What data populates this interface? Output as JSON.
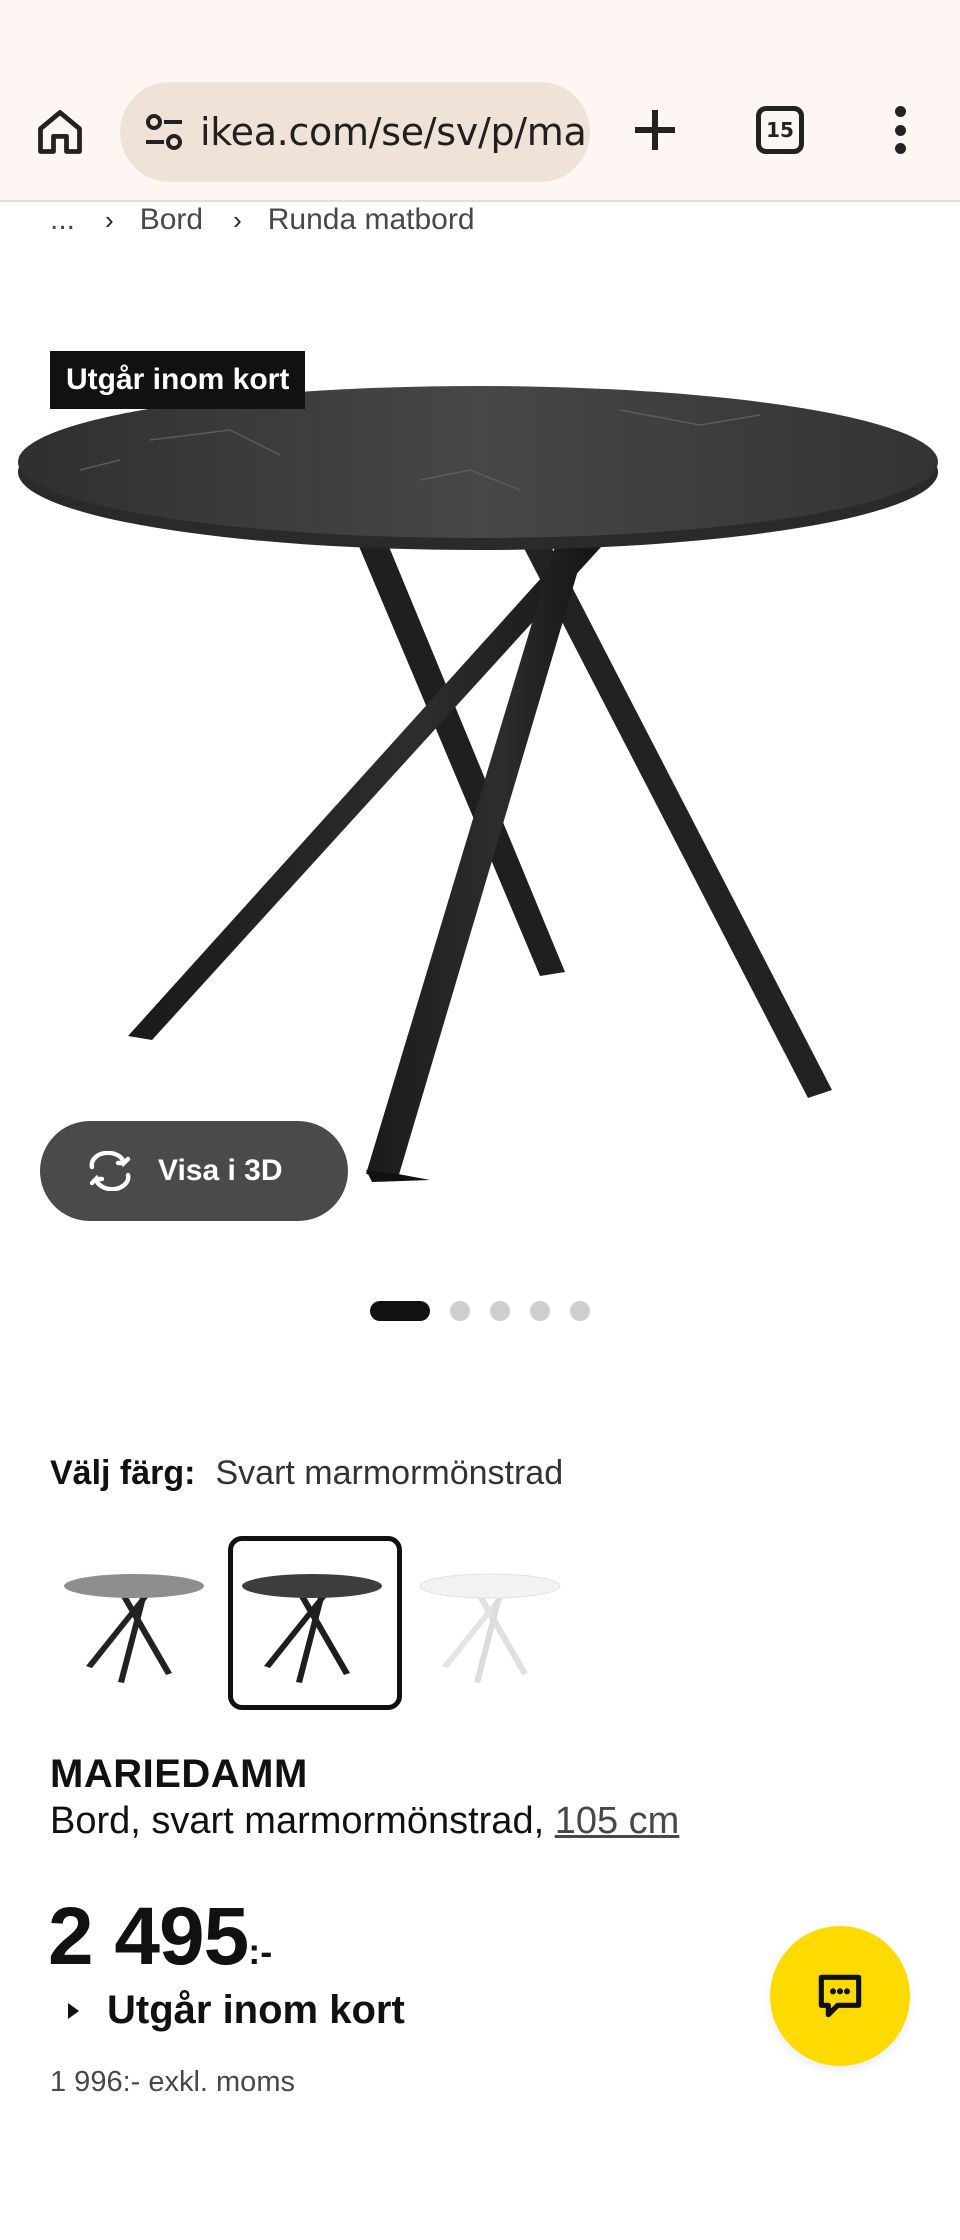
{
  "browser": {
    "url": "ikea.com/se/sv/p/mar",
    "tab_count": "15",
    "icons": [
      "home-icon",
      "site-settings-icon",
      "plus-icon",
      "tab-switcher-icon",
      "more-vertical-icon"
    ]
  },
  "breadcrumb": {
    "items": [
      "...",
      "Bord",
      "Runda matbord"
    ]
  },
  "product_image": {
    "badge": "Utgår inom kort",
    "view3d_label": "Visa i 3D",
    "carousel": {
      "total": 5,
      "active": 1
    }
  },
  "color": {
    "label": "Välj färg:",
    "selected": "Svart marmormönstrad",
    "swatches": [
      {
        "top_color": "#8d8f8d",
        "leg_color": "#222222",
        "selected": false
      },
      {
        "top_color": "#3d3d3d",
        "leg_color": "#1e1e1e",
        "selected": true
      },
      {
        "top_color": "#f2f2f2",
        "leg_color": "#e4e4e4",
        "selected": false
      }
    ]
  },
  "product": {
    "name": "MARIEDAMM",
    "description": "Bord, svart marmormönstrad, ",
    "size": "105 cm",
    "price": "2 495",
    "price_suffix": ":-",
    "availability": "Utgår inom kort",
    "price_excl_vat": "1 996:- exkl. moms"
  },
  "colors": {
    "ikea_yellow": "#fedb00",
    "badge_bg": "#111111",
    "view3d_bg": "#4a4a4a"
  }
}
